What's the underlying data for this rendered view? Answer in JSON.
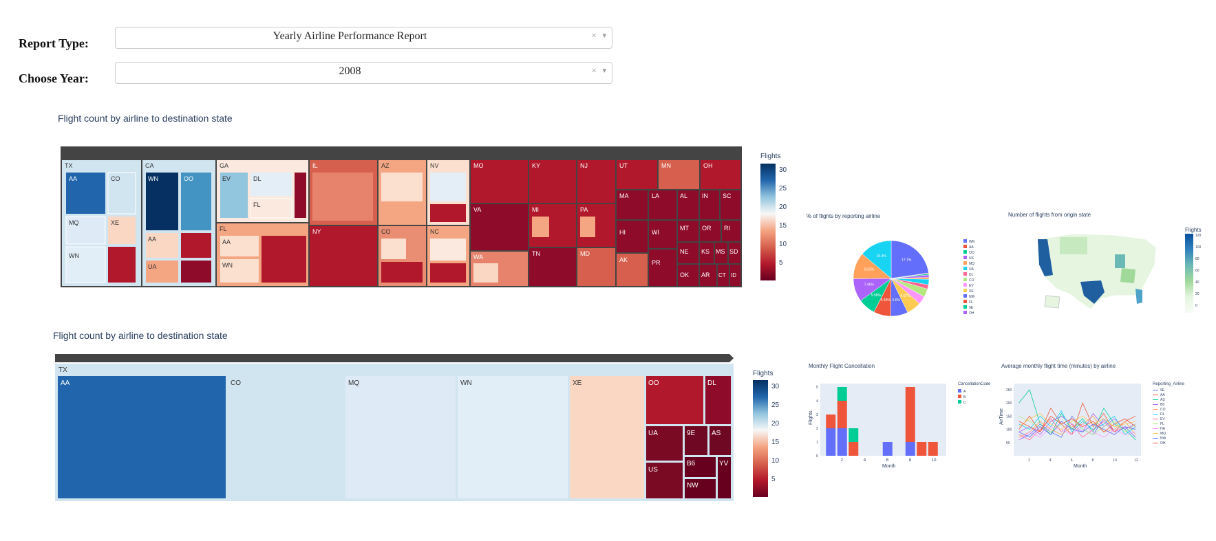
{
  "controls": {
    "report_label": "Report Type:",
    "report_value": "Yearly Airline Performance Report",
    "year_label": "Choose Year:",
    "year_value": "2008",
    "clear_glyph": "×",
    "caret_glyph": "▾"
  },
  "treemap1": {
    "title": "Flight count by airline to destination state",
    "colorbar_title": "Flights",
    "colorbar_ticks": [
      "30",
      "25",
      "20",
      "15",
      "10",
      "5"
    ]
  },
  "pie": {
    "title": "% of flights by reporting airline",
    "labels": [
      "17.1%",
      "0.207%",
      "0.401%",
      "0.802%",
      "0.602%",
      "1.74%",
      "1.4%",
      "2.67%",
      "2.67%",
      "4.67%",
      "5.6%",
      "5.48%",
      "5.58%",
      "7.46%",
      "8.53%",
      "10.4%"
    ],
    "legend": [
      "WN",
      "AA",
      "OO",
      "US",
      "MQ",
      "UA",
      "DL",
      "CO",
      "EV",
      "XE",
      "NW",
      "FL",
      "9E",
      "OH"
    ]
  },
  "map": {
    "title": "Number of flights from origin state",
    "colorbar_title": "Flights",
    "colorbar_ticks": [
      "120",
      "100",
      "80",
      "60",
      "40",
      "20",
      "0"
    ]
  },
  "treemap2": {
    "title": "Flight count by airline to destination state",
    "state": "TX",
    "tiles": [
      "AA",
      "CO",
      "MQ",
      "WN",
      "XE",
      "OO",
      "DL",
      "UA",
      "9E",
      "AS",
      "B6",
      "YV",
      "US",
      "NW"
    ],
    "colorbar_title": "Flights",
    "colorbar_ticks": [
      "30",
      "25",
      "20",
      "15",
      "10",
      "5"
    ]
  },
  "cancel": {
    "title": "Monthly Flight Cancellation",
    "xlabel": "Month",
    "ylabel": "Flights",
    "legend_title": "CancellationCode",
    "legend": [
      "A",
      "B",
      "C"
    ],
    "xticks": [
      "2",
      "4",
      "6",
      "8",
      "10"
    ],
    "yticks": [
      "0",
      "1",
      "2",
      "3",
      "4",
      "5"
    ]
  },
  "airtime": {
    "title": "Average monthly flight time (minutes) by airline",
    "xlabel": "Month",
    "ylabel": "AirTime",
    "legend_title": "Reporting_Airline",
    "legend": [
      "9E",
      "AA",
      "AS",
      "B6",
      "CO",
      "DL",
      "EV",
      "FL",
      "HA",
      "MQ",
      "NW",
      "OH"
    ],
    "xticks": [
      "2",
      "4",
      "6",
      "8",
      "10",
      "12"
    ],
    "yticks": [
      "50",
      "100",
      "150",
      "200",
      "250"
    ]
  },
  "colors": {
    "blue_dark": "#053061",
    "blue": "#2166ac",
    "red_dark": "#67001f",
    "red": "#b2182b",
    "light": "#f7f7f7",
    "pie_a": "#636efa",
    "pie_b": "#ef553b",
    "pie_c": "#00cc96"
  }
}
